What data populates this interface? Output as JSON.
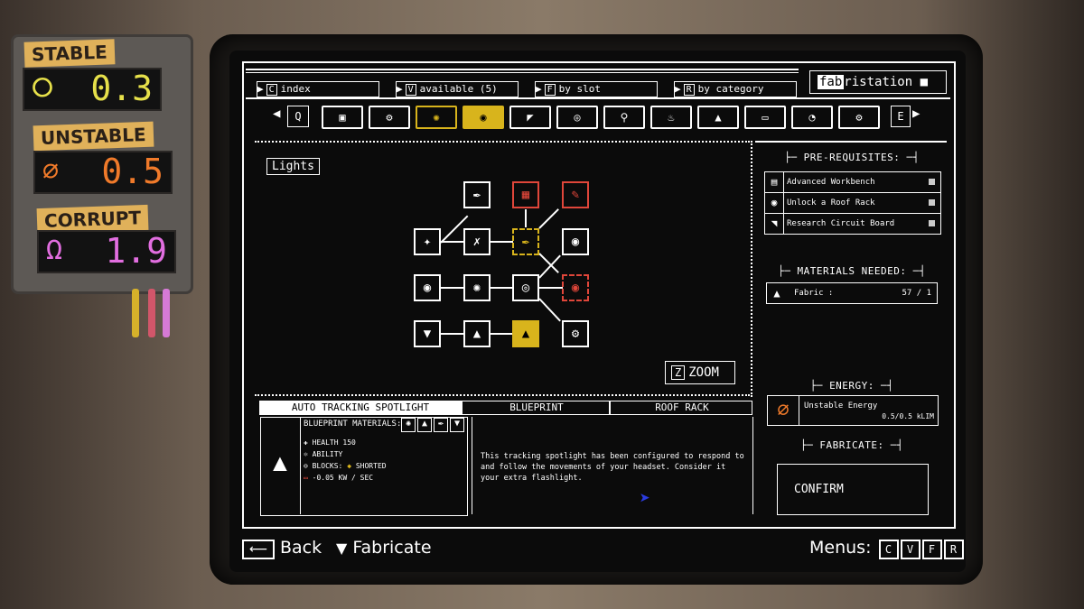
{
  "meter": {
    "stable_label": "STABLE",
    "stable_value": "0.3",
    "unstable_label": "UNSTABLE",
    "unstable_value": "0.5",
    "corrupt_label": "CORRUPT",
    "corrupt_value": "1.9",
    "colors": {
      "stable": "#e6e04a",
      "unstable": "#f07a2a",
      "corrupt": "#e26ee0"
    }
  },
  "tabs": [
    {
      "key": "C",
      "label": "index"
    },
    {
      "key": "V",
      "label": "available (5)"
    },
    {
      "key": "F",
      "label": "by slot"
    },
    {
      "key": "R",
      "label": "by category"
    }
  ],
  "brand": {
    "highlight": "fab",
    "rest": "ristation"
  },
  "category_row": {
    "prev_key": "Q",
    "next_key": "E"
  },
  "tree": {
    "title": "Lights",
    "zoom_key": "Z",
    "zoom_label": "ZOOM"
  },
  "detail": {
    "name": "AUTO TRACKING SPOTLIGHT",
    "type": "BLUEPRINT",
    "slot": "ROOF RACK",
    "materials_label": "BLUEPRINT MATERIALS:",
    "health": "HEALTH  150",
    "ability": "ABILITY",
    "blocks_label": "BLOCKS:",
    "blocks_value": "SHORTED",
    "power": "-0.05 KW / SEC",
    "description": "This tracking spotlight has been configured to respond to and follow the movements of your headset. Consider it your extra flashlight."
  },
  "sidebar": {
    "prereq_header": "PRE-REQUISITES:",
    "prereqs": [
      "Advanced Workbench",
      "Unlock a Roof Rack",
      "Research Circuit Board"
    ],
    "materials_header": "MATERIALS NEEDED:",
    "material_name": "Fabric  :",
    "material_count": "57 / 1",
    "energy_header": "ENERGY:",
    "energy_name": "Unstable Energy",
    "energy_value": "0.5/0.5 kLIM",
    "fabricate_header": "FABRICATE:",
    "confirm": "CONFIRM"
  },
  "footer": {
    "back": "Back",
    "fabricate": "Fabricate",
    "menus": "Menus:",
    "menu_keys": [
      "C",
      "V",
      "F",
      "R"
    ]
  }
}
